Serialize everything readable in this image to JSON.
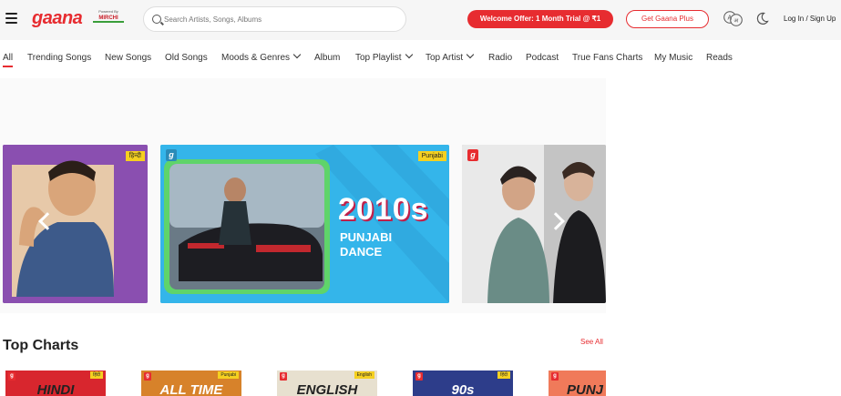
{
  "header": {
    "logo_text": "gaana",
    "powered_by": "Powered By",
    "powered_brand": "MIRCHI",
    "search_placeholder": "Search Artists, Songs, Albums",
    "offer_label": "Welcome Offer: 1 Month Trial @ ₹1",
    "plus_label": "Get Gaana Plus",
    "login_label": "Log In / Sign Up",
    "icons": [
      "menu-icon",
      "search-icon",
      "language-icon",
      "moon-icon"
    ]
  },
  "nav": {
    "items": [
      {
        "label": "All",
        "active": true
      },
      {
        "label": "Trending Songs"
      },
      {
        "label": "New Songs"
      },
      {
        "label": "Old Songs"
      },
      {
        "label": "Moods & Genres",
        "dropdown": true
      },
      {
        "label": "Album"
      },
      {
        "label": "Top Playlist",
        "dropdown": true
      },
      {
        "label": "Top Artist",
        "dropdown": true
      },
      {
        "label": "Radio"
      },
      {
        "label": "Podcast"
      },
      {
        "label": "True Fans Charts"
      },
      {
        "label": "My Music"
      },
      {
        "label": "Reads"
      }
    ]
  },
  "carousel": {
    "banners": [
      {
        "tag": "हिन्दी"
      },
      {
        "tag": "Punjabi",
        "badge": "g",
        "title": "2010s",
        "subtitle_line1": "PUNJABI",
        "subtitle_line2": "DANCE"
      },
      {
        "badge": "g"
      }
    ]
  },
  "top_charts": {
    "title": "Top Charts",
    "see_all": "See All",
    "cards": [
      {
        "text": "HINDI",
        "tag": "हिंदी",
        "bg": "#d8262e",
        "color": "#222222"
      },
      {
        "text": "ALL TIME",
        "tag": "Punjabi",
        "bg": "#d7822a",
        "color": "#ffffff"
      },
      {
        "text": "ENGLISH",
        "tag": "English",
        "bg": "#e7e0cf",
        "color": "#222222"
      },
      {
        "text": "90s",
        "tag": "हिंदी",
        "bg": "#2d3d8a",
        "color": "#ffffff"
      },
      {
        "text": "PUNJ",
        "tag": "",
        "bg": "#f07a5a",
        "color": "#222222"
      }
    ]
  },
  "colors": {
    "brand_red": "#e72c30",
    "header_bg": "#f6f6f6",
    "tag_yellow": "#f5d020"
  }
}
